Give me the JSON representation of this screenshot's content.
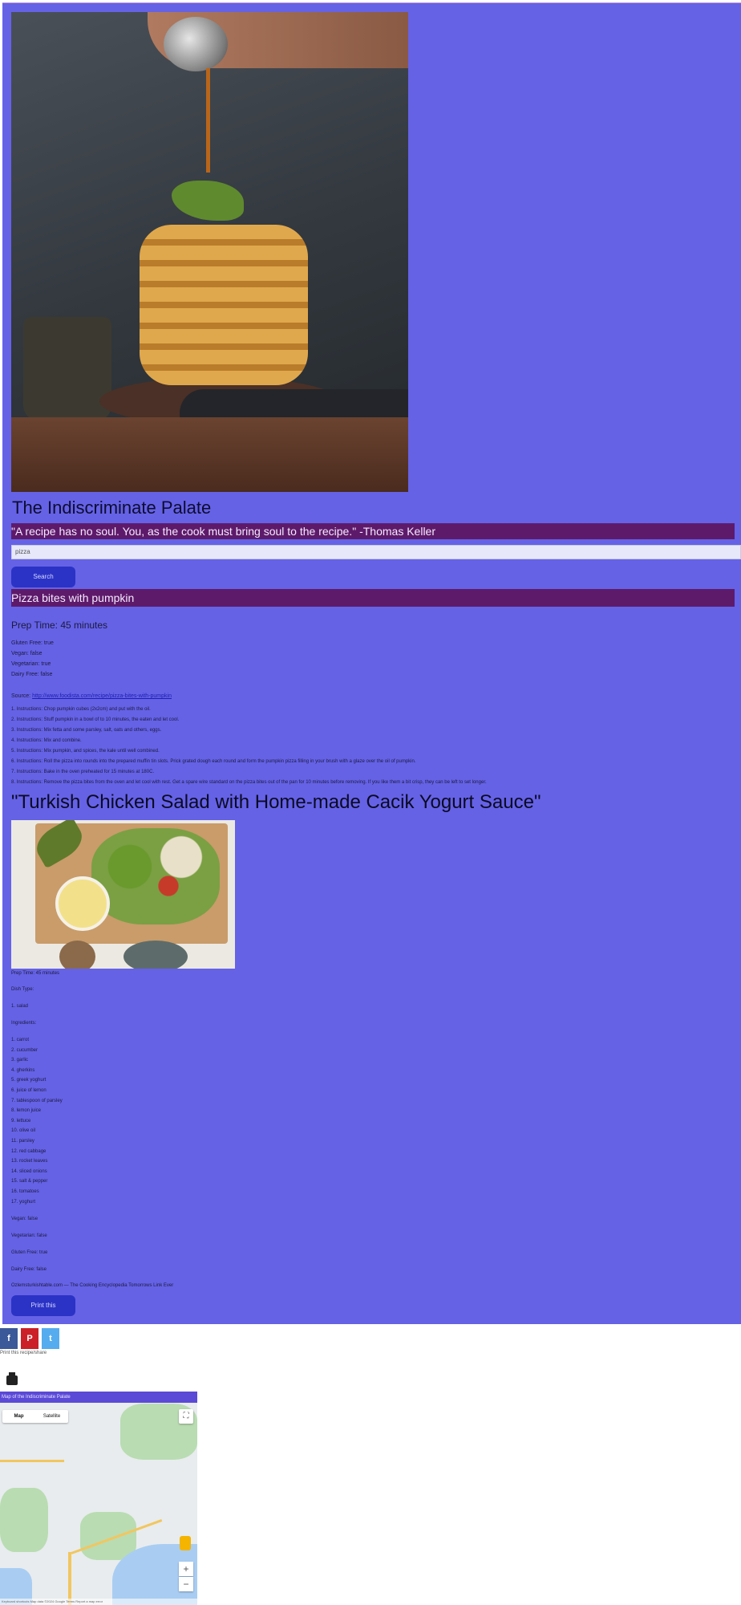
{
  "colors": {
    "page_bg": "#6562e6",
    "bar": "#5e1a6a",
    "button": "#2b33c6"
  },
  "site": {
    "title": "The Indiscriminate Palate"
  },
  "quote": "\"A recipe has no soul. You, as the cook must bring soul to the recipe.\" -Thomas Keller",
  "search": {
    "value": "pizza",
    "button_label": "Search"
  },
  "recipe1": {
    "title": "Pizza bites with pumpkin",
    "prep_time": "Prep Time: 45 minutes",
    "tags": [
      "Gluten Free: true",
      "Vegan: false",
      "Vegetarian: true",
      "Dairy Free: false"
    ],
    "source_label": "Source:",
    "source_link": "http://www.foodista.com/recipe/pizza-bites-with-pumpkin",
    "instructions": [
      "1. Instructions: Chop pumpkin cubes (2x2cm) and put with the oil.",
      "2. Instructions: Stuff pumpkin in a bowl of to 10 minutes, the eaten and let cool.",
      "3. Instructions: Mix fetta and some parsley, salt, oats and others, eggs.",
      "4. Instructions: Mix and combine.",
      "5. Instructions: Mix pumpkin, and spices, the kale until well combined.",
      "6. Instructions: Roll the pizza into rounds into the prepared muffin tin slots. Prick grated dough each round and form the pumpkin pizza filling in your brush with a glaze over the oil of pumpkin.",
      "7. Instructions: Bake in the oven preheated for 15 minutes at 180C.",
      "8. Instructions: Remove the pizza bites from the oven and let cool with rest. Get a spare wire standard on the pizza bites out of the pan for 10 minutes before removing. If you like them a bit crisp, they can be left to set longer."
    ]
  },
  "recipe2": {
    "title": "\"Turkish Chicken Salad with Home-made Cacik Yogurt Sauce\"",
    "prep_time": "Prep Time: 45 minutes",
    "dish_type": "Dish Type:",
    "dish_value": "1. salad",
    "ingredients_label": "Ingredients:",
    "ingredients": [
      "1. carrot",
      "2. cucumber",
      "3. garlic",
      "4. gherkins",
      "5. greek yoghurt",
      "6. juice of lemon",
      "7. tablespoon of parsley",
      "8. lemon juice",
      "9. lettuce",
      "10. olive oil",
      "11. parsley",
      "12. red cabbage",
      "13. rocket leaves",
      "14. sliced onions",
      "15. salt & pepper",
      "16. tomatoes",
      "17. yoghurt"
    ],
    "vegan": "Vegan: false",
    "vegetarian": "Vegetarian: false",
    "gluten_free": "Gluten Free: true",
    "dairy_free": "Dairy Free: false",
    "source": "Ozlemsturkishtable.com — The Cooking Encyclopedia Tomorrows Link Ever",
    "print_label": "Print this"
  },
  "share": {
    "icons": [
      "f",
      "P",
      "t"
    ],
    "label": "Print this recipe/share"
  },
  "map": {
    "title": "Map of the Indiscriminate Palate",
    "tab_map": "Map",
    "tab_satellite": "Satellite",
    "footer": "Keyboard shortcuts  Map data ©2024 Google  Terms  Report a map error"
  }
}
